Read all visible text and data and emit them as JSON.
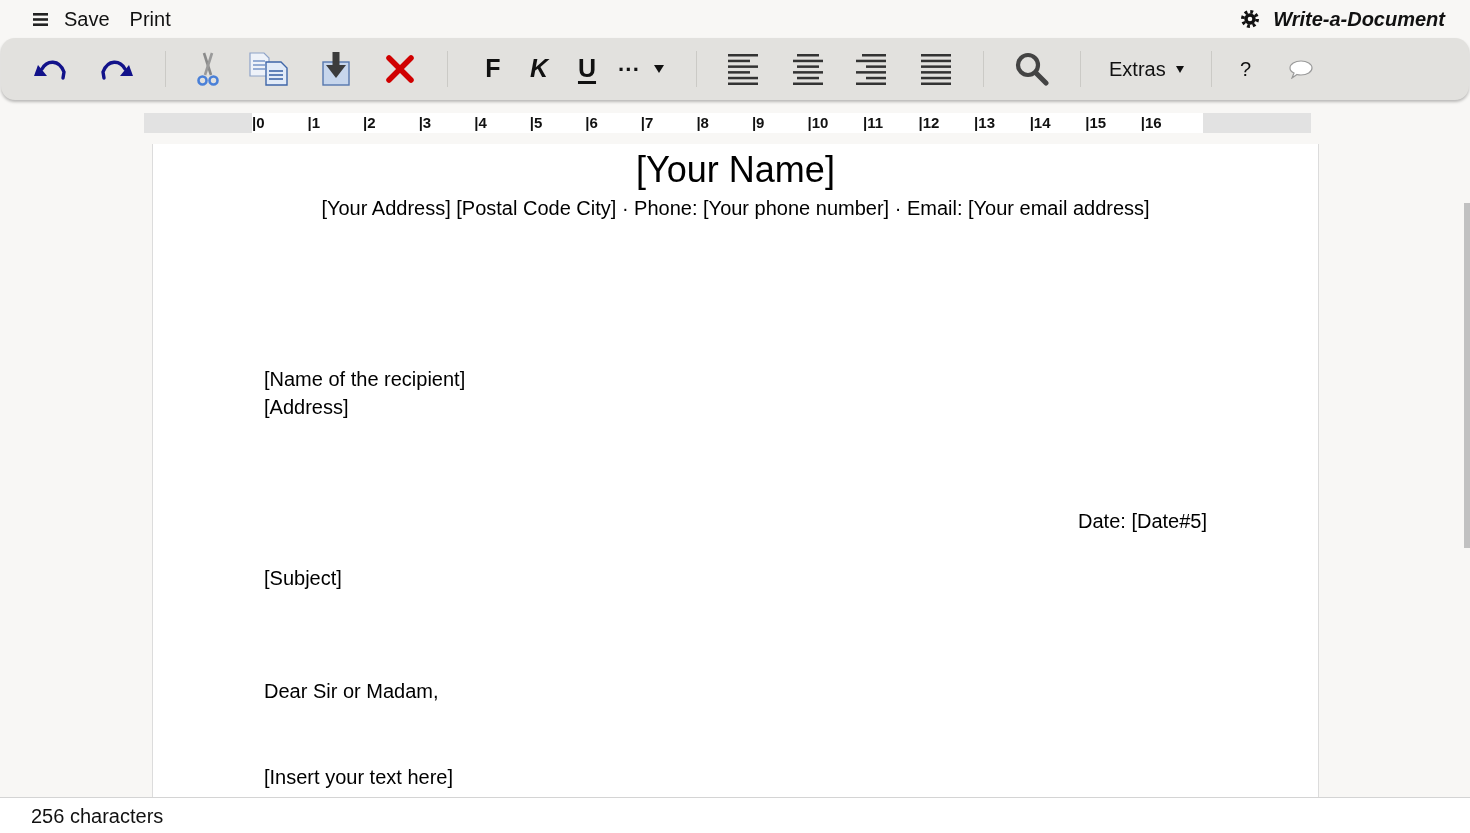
{
  "top_bar": {
    "menu_items": [
      {
        "label": "Save"
      },
      {
        "label": "Print"
      }
    ],
    "app_title": "Write-a-Document"
  },
  "toolbar": {
    "format_buttons": [
      {
        "kind": "bold",
        "label": "F"
      },
      {
        "kind": "italic",
        "label": "K"
      },
      {
        "kind": "underline",
        "label": "U"
      }
    ],
    "more_label": "···",
    "extras_label": "Extras",
    "help_label": "?"
  },
  "ruler": {
    "marks": [
      "|0",
      "|1",
      "|2",
      "|3",
      "|4",
      "|5",
      "|6",
      "|7",
      "|8",
      "|9",
      "|10",
      "|11",
      "|12",
      "|13",
      "|14",
      "|15",
      "|16"
    ]
  },
  "document": {
    "title": "[Your Name]",
    "contact_line": "[Your Address] [Postal Code City] · Phone: [Your phone number] · Email: [Your email address]",
    "recipient_lines": [
      "[Name of the recipient]",
      "[Address]"
    ],
    "date": "Date: [Date#5]",
    "subject": "[Subject]",
    "salutation": "Dear Sir or Madam,",
    "body": "[Insert your text here]"
  },
  "status_bar": {
    "character_count": "256 characters"
  }
}
